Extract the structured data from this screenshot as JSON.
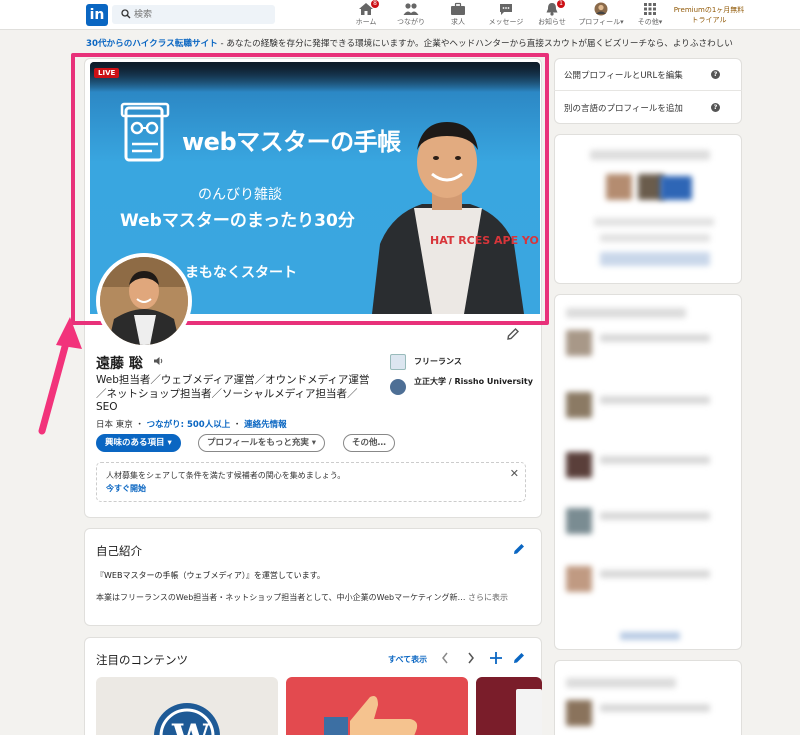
{
  "nav": {
    "search_placeholder": "検索",
    "items": [
      {
        "label": "ホーム",
        "badge": "8"
      },
      {
        "label": "つながり",
        "badge": ""
      },
      {
        "label": "求人",
        "badge": ""
      },
      {
        "label": "メッセージ",
        "badge": ""
      },
      {
        "label": "お知らせ",
        "badge": "1"
      },
      {
        "label": "プロフィール▾",
        "badge": ""
      },
      {
        "label": "その他▾",
        "badge": ""
      }
    ],
    "premium_line1": "Premiumの1ヶ月無料",
    "premium_line2": "トライアル"
  },
  "promo": {
    "highlight": "30代からのハイクラス転職サイト",
    "text": " - あなたの経験を存分に発揮できる環境にいますか。企業やヘッドハンターから直接スカウトが届くビズリーチなら、よりふさわしい"
  },
  "cover": {
    "live_label": "LIVE",
    "brand": "webマスターの手帳",
    "subtitle": "のんびり雑談",
    "headline": "Webマスターのまったり30分",
    "starting": "まもなくスタート",
    "shirt_text": "HAT RCES APE YO"
  },
  "profile": {
    "name": "遠藤 聡",
    "headline": "Web担当者／ウェブメディア運営／オウンドメディア運営／ネットショップ担当者／ソーシャルメディア担当者／SEO",
    "location": "日本 東京",
    "connections": "つながり: 500人以上",
    "contact": "連絡先情報",
    "companies": [
      {
        "name": "フリーランス"
      },
      {
        "name": "立正大学 / Rissho University"
      }
    ],
    "buttons": {
      "open_to": "興味のある項目 ▾",
      "enhance": "プロフィールをもっと充実 ▾",
      "more": "その他…"
    },
    "hiring": {
      "text": "人材募集をシェアして条件を満たす候補者の関心を集めましょう。",
      "cta": "今すぐ開始"
    }
  },
  "about": {
    "title": "自己紹介",
    "line1": "『WEBマスターの手帳（ウェブメディア）』を運営しています。",
    "line2": "本業はフリーランスのWeb担当者・ネットショップ担当者として、中小企業のWebマーケティング新…",
    "more": "さらに表示"
  },
  "featured": {
    "title": "注目のコンテンツ",
    "show_all": "すべて表示"
  },
  "sidebar": {
    "links": [
      {
        "label": "公開プロフィールとURLを編集"
      },
      {
        "label": "別の言語のプロフィールを追加"
      }
    ]
  },
  "colors": {
    "brand": "#0a66c2",
    "highlight": "#e8317a",
    "cover": "#3aa6e0"
  }
}
